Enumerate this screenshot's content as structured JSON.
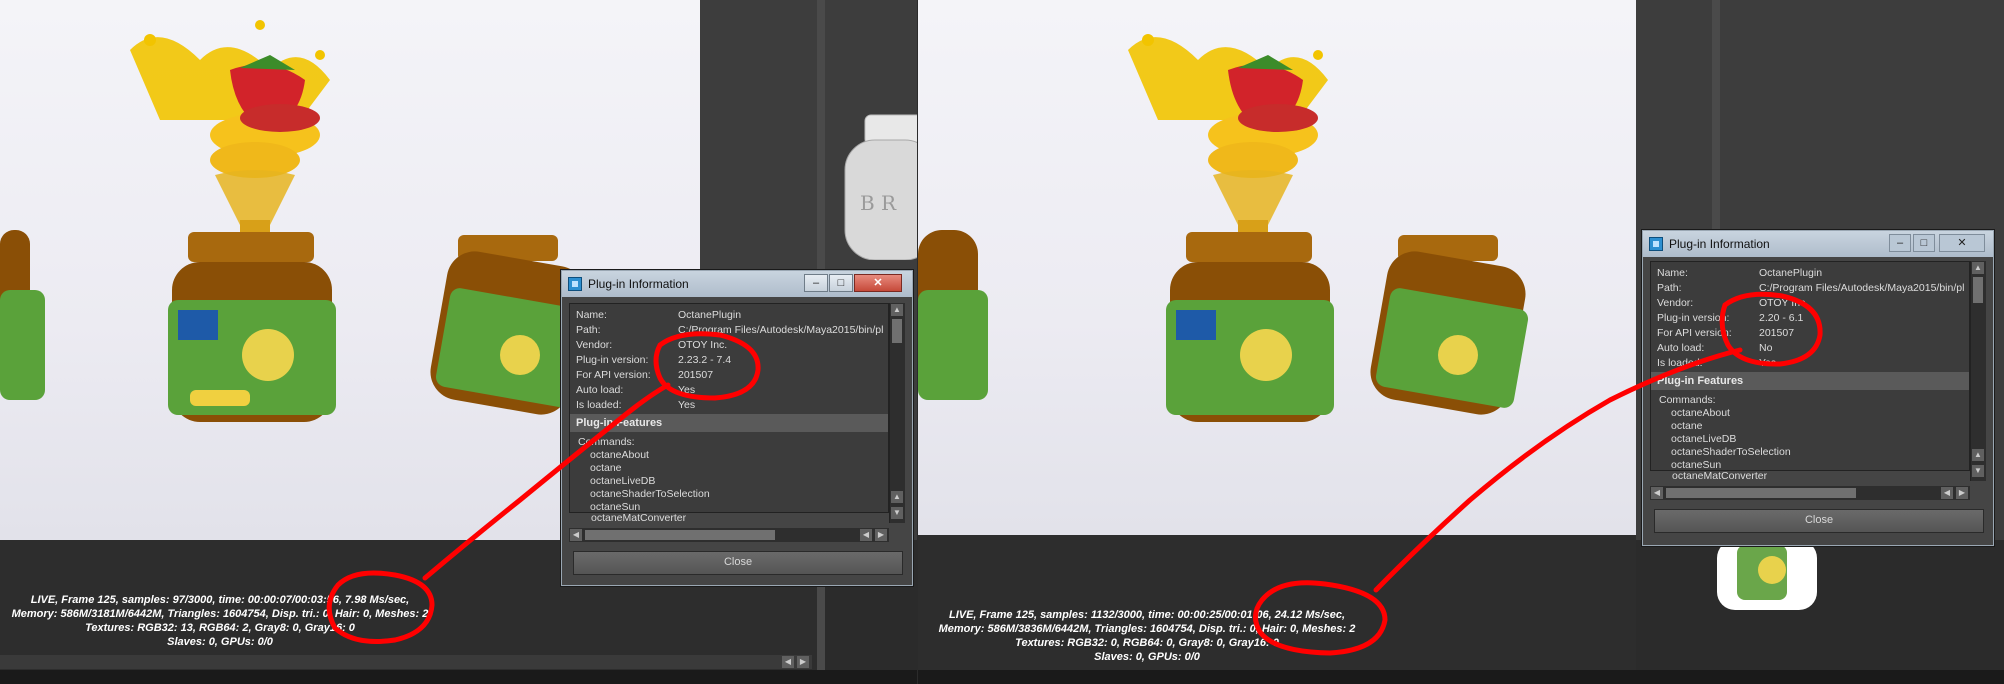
{
  "left": {
    "dialog": {
      "title": "Plug-in Information",
      "rows": [
        {
          "key": "Name:",
          "value": "OctanePlugin"
        },
        {
          "key": "Path:",
          "value": "C:/Program Files/Autodesk/Maya2015/bin/pl"
        },
        {
          "key": "Vendor:",
          "value": "OTOY Inc."
        },
        {
          "key": "Plug-in version:",
          "value": "2.23.2 - 7.4"
        },
        {
          "key": "For API version:",
          "value": "201507"
        },
        {
          "key": "Auto load:",
          "value": "Yes"
        },
        {
          "key": "Is loaded:",
          "value": "Yes"
        }
      ],
      "features_label": "Plug-in Features",
      "commands_label": "Commands:",
      "commands": [
        "octaneAbout",
        "octane",
        "octaneLiveDB",
        "octaneShaderToSelection",
        "octaneSun",
        "octaneMatConverter"
      ],
      "close_label": "Close"
    },
    "stats": [
      "LIVE, Frame 125, samples: 97/3000, time: 00:00:07/00:03:56, 7.98 Ms/sec,",
      "Memory: 586M/3181M/6442M, Triangles: 1604754, Disp. tri.: 0, Hair: 0, Meshes: 2",
      "Textures: RGB32: 13, RGB64: 2, Gray8: 0, Gray16: 0",
      "Slaves: 0, GPUs: 0/0"
    ]
  },
  "right": {
    "dialog": {
      "title": "Plug-in Information",
      "rows": [
        {
          "key": "Name:",
          "value": "OctanePlugin"
        },
        {
          "key": "Path:",
          "value": "C:/Program Files/Autodesk/Maya2015/bin/pl"
        },
        {
          "key": "Vendor:",
          "value": "OTOY Inc."
        },
        {
          "key": "Plug-in version:",
          "value": "2.20 - 6.1"
        },
        {
          "key": "For API version:",
          "value": "201507"
        },
        {
          "key": "Auto load:",
          "value": "No"
        },
        {
          "key": "Is loaded:",
          "value": "Yes"
        }
      ],
      "features_label": "Plug-in Features",
      "commands_label": "Commands:",
      "commands": [
        "octaneAbout",
        "octane",
        "octaneLiveDB",
        "octaneShaderToSelection",
        "octaneSun",
        "octaneMatConverter"
      ],
      "close_label": "Close"
    },
    "stats": [
      "LIVE, Frame 125, samples: 1132/3000, time: 00:00:25/00:01:06, 24.12 Ms/sec,",
      "Memory: 586M/3836M/6442M, Triangles: 1604754, Disp. tri.: 0, Hair: 0, Meshes: 2",
      "Textures: RGB32: 0, RGB64: 0, Gray8: 0, Gray16: 0",
      "Slaves: 0, GPUs: 0/0"
    ]
  },
  "colors": {
    "annotation_red": "#ff0000",
    "viewport_bg": "#f0f0f5",
    "maya_dark": "#2b2b2b",
    "dialog_title": "#b8c6d4"
  },
  "icons": [
    "maya-app-icon",
    "minimize-icon",
    "maximize-icon",
    "close-icon",
    "scroll-up-icon",
    "scroll-down-icon",
    "scroll-left-icon",
    "scroll-right-icon"
  ]
}
